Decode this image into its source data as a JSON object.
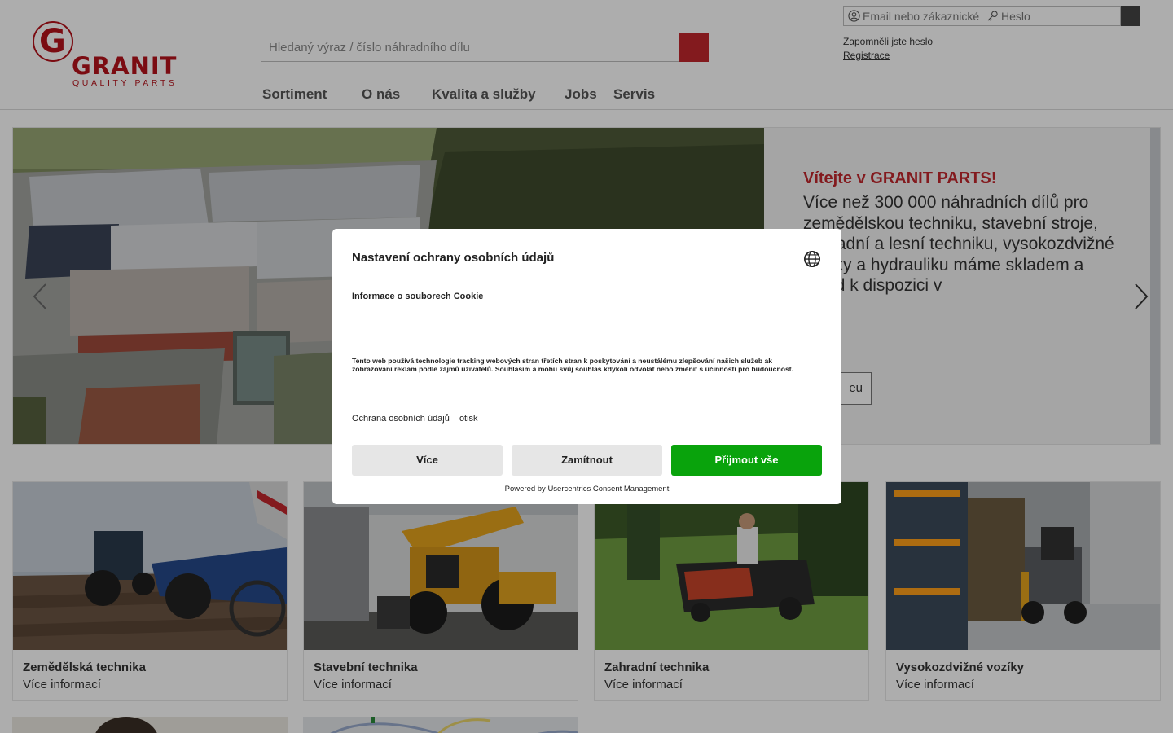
{
  "header": {
    "logo": {
      "letter": "G",
      "brand": "GRANIT",
      "tagline": "QUALITY PARTS"
    },
    "search": {
      "placeholder": "Hledaný výraz / číslo náhradního dílu"
    },
    "login": {
      "email_placeholder": "Email nebo zákaznické",
      "password_placeholder": "Heslo",
      "forgot_link": "Zapomněli jste heslo",
      "register_link": "Registrace"
    },
    "nav": [
      "Sortiment",
      "O nás",
      "Kvalita a služby",
      "Jobs",
      "Servis"
    ]
  },
  "hero": {
    "welcome": "Vítejte v GRANIT PARTS!",
    "body": "Více než 300 000 náhradních dílů pro zemědělskou techniku, stavební stroje, zahradní a lesní techniku, vysokozdvižné vozíky a hydrauliku máme skladem a ihned k dispozici v",
    "button_fragment": "eu"
  },
  "categories": [
    {
      "title": "Zemědělská technika",
      "more": "Více informací"
    },
    {
      "title": "Stavební technika",
      "more": "Více informací"
    },
    {
      "title": "Zahradní technika",
      "more": "Více informací"
    },
    {
      "title": "Vysokozdvižné vozíky",
      "more": "Více informací"
    }
  ],
  "consent": {
    "title": "Nastavení ochrany osobních údajů",
    "subtitle": "Informace o souborech Cookie",
    "text": "Tento web používá technologie tracking webových stran třetích stran k poskytování a neustálému zlepšování našich služeb ak zobrazování reklam podle zájmů uživatelů. Souhlasím a mohu svůj souhlas kdykoli odvolat nebo změnit s účinností pro budoucnost.",
    "link_privacy": "Ochrana osobních údajů",
    "link_imprint": "otisk",
    "btn_more": "Více",
    "btn_deny": "Zamítnout",
    "btn_accept": "Přijmout vše",
    "powered": "Powered by Usercentrics Consent Management"
  },
  "colors": {
    "brand_red": "#b5121b",
    "accept_green": "#09a30c"
  }
}
